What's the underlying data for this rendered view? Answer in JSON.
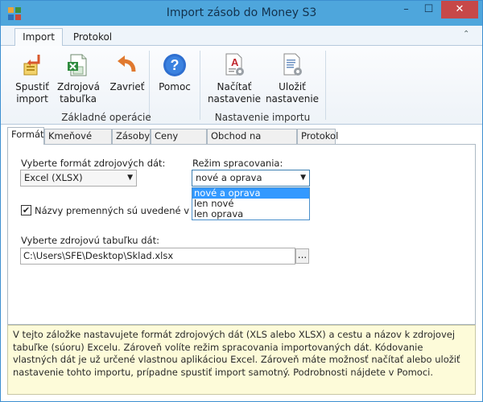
{
  "window": {
    "title": "Import zásob do Money S3",
    "minimize": "–",
    "maximize": "☐",
    "close": "✕"
  },
  "ribbon_tabs": {
    "import": "Import",
    "protokol": "Protokol",
    "collapse": "⌃"
  },
  "ribbon": {
    "buttons": {
      "run": {
        "line1": "Spustiť",
        "line2": "import",
        "icon": "run-import-icon"
      },
      "source": {
        "line1": "Zdrojová",
        "line2": "tabuľka",
        "icon": "excel-sheet-icon"
      },
      "close": {
        "line1": "Zavrieť",
        "icon": "close-undo-icon"
      },
      "help": {
        "line1": "Pomoc",
        "icon": "help-icon"
      },
      "load": {
        "line1": "Načítať",
        "line2": "nastavenie",
        "icon": "load-settings-icon"
      },
      "save": {
        "line1": "Uložiť",
        "line2": "nastavenie",
        "icon": "save-settings-icon"
      }
    },
    "groups": {
      "basic": "Základné operácie",
      "settings": "Nastavenie importu"
    }
  },
  "tabs": [
    "Formát",
    "Kmeňové karty",
    "Zásoby",
    "Ceny zásob",
    "Obchod na internete",
    "Protokol"
  ],
  "format": {
    "format_label": "Vyberte formát zdrojových dát:",
    "format_value": "Excel (XLSX)",
    "mode_label": "Režim spracovania:",
    "mode_value": "nové a oprava",
    "mode_options": [
      "nové a oprava",
      "len nové",
      "len oprava"
    ],
    "checkbox_label": "Názvy premenných sú uvedené v prvom r",
    "checkbox_checked": "✔",
    "source_label": "Vyberte zdrojovú tabuľku dát:",
    "source_value": "C:\\Users\\SFE\\Desktop\\Sklad.xlsx",
    "browse": "..."
  },
  "info_text": "V tejto záložke nastavujete formát zdrojových dát (XLS alebo XLSX) a cestu a názov k zdrojovej tabuľke (súoru) Excelu. Zároveň volíte režim spracovania importovaných dát. Kódovanie vlastných dát je už určené vlastnou aplikáciou Excel. Zároveň máte možnosť načítať alebo uložiť nastavenie tohto importu, prípadne spustiť import samotný. Podrobnosti nájdete v Pomoci."
}
